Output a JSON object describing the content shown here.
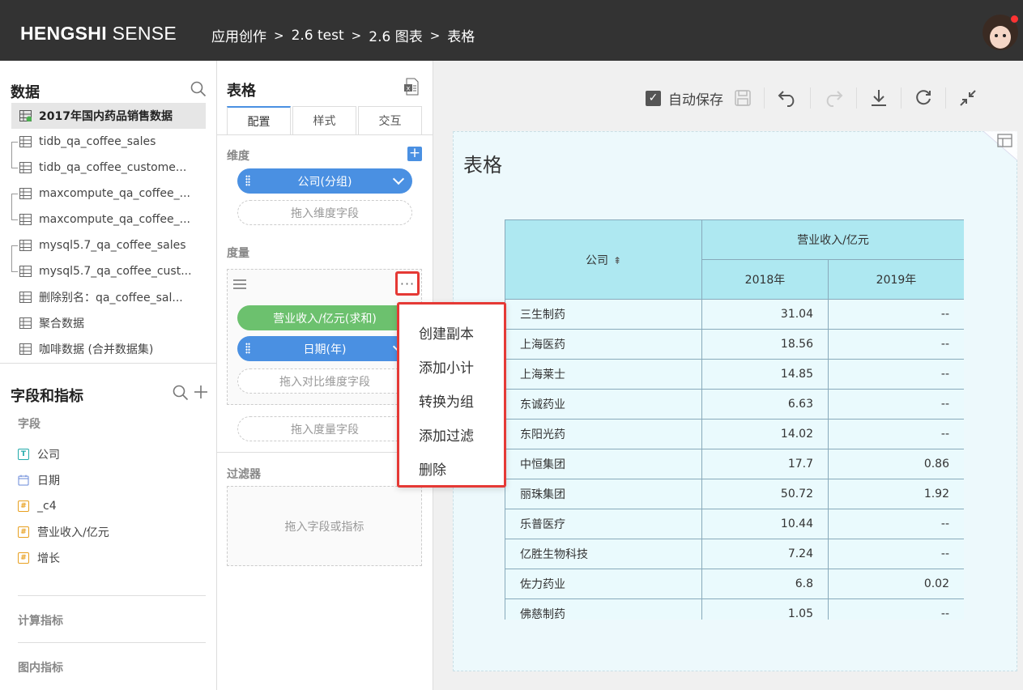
{
  "header": {
    "brand_bold": "HENGSHI",
    "brand_light": " SENSE",
    "breadcrumbs": [
      "应用创作",
      "2.6 test",
      "2.6 图表",
      "表格"
    ],
    "separator": ">"
  },
  "data_panel": {
    "title": "数据",
    "datasets": [
      {
        "label": "2017年国内药品销售数据"
      },
      {
        "label": "tidb_qa_coffee_sales"
      },
      {
        "label": "tidb_qa_coffee_custome..."
      },
      {
        "label": "maxcompute_qa_coffee_..."
      },
      {
        "label": "maxcompute_qa_coffee_..."
      },
      {
        "label": "mysql5.7_qa_coffee_sales"
      },
      {
        "label": "mysql5.7_qa_coffee_cust..."
      },
      {
        "label": "删除别名：qa_coffee_sal..."
      },
      {
        "label": "聚合数据"
      },
      {
        "label": "咖啡数据 (合并数据集)"
      }
    ]
  },
  "fields_panel": {
    "title": "字段和指标",
    "fields_label": "字段",
    "fields": [
      {
        "type": "T",
        "label": "公司"
      },
      {
        "type": "date",
        "label": "日期"
      },
      {
        "type": "#",
        "label": "_c4"
      },
      {
        "type": "#",
        "label": "营业收入/亿元"
      },
      {
        "type": "#",
        "label": "增长"
      }
    ],
    "calc_label": "计算指标",
    "inchart_label": "图内指标"
  },
  "config_panel": {
    "title": "表格",
    "tabs": [
      "配置",
      "样式",
      "交互"
    ],
    "dimension_label": "维度",
    "dimension_pill": "公司(分组)",
    "dimension_drop": "拖入维度字段",
    "measure_label": "度量",
    "measure_pill": "营业收入/亿元(求和)",
    "compare_pill": "日期(年)",
    "compare_drop": "拖入对比维度字段",
    "measure_drop": "拖入度量字段",
    "filter_label": "过滤器",
    "filter_drop": "拖入字段或指标",
    "more_glyph": "···"
  },
  "context_menu": {
    "items": [
      "创建副本",
      "添加小计",
      "转换为组",
      "添加过滤",
      "删除"
    ]
  },
  "toolbar": {
    "autosave_label": "自动保存",
    "autosave_checked": true
  },
  "chart": {
    "title": "表格"
  },
  "chart_data": {
    "type": "table",
    "row_header": "公司",
    "group_header": "营业收入/亿元",
    "columns": [
      "2018年",
      "2019年"
    ],
    "rows": [
      {
        "name": "三生制药",
        "v2018": "31.04",
        "v2019": "--"
      },
      {
        "name": "上海医药",
        "v2018": "18.56",
        "v2019": "--"
      },
      {
        "name": "上海莱士",
        "v2018": "14.85",
        "v2019": "--"
      },
      {
        "name": "东诚药业",
        "v2018": "6.63",
        "v2019": "--"
      },
      {
        "name": "东阳光药",
        "v2018": "14.02",
        "v2019": "--"
      },
      {
        "name": "中恒集团",
        "v2018": "17.7",
        "v2019": "0.86"
      },
      {
        "name": "丽珠集团",
        "v2018": "50.72",
        "v2019": "1.92"
      },
      {
        "name": "乐普医疗",
        "v2018": "10.44",
        "v2019": "--"
      },
      {
        "name": "亿胜生物科技",
        "v2018": "7.24",
        "v2019": "--"
      },
      {
        "name": "佐力药业",
        "v2018": "6.8",
        "v2019": "0.02"
      },
      {
        "name": "佛慈制药",
        "v2018": "1.05",
        "v2019": "--"
      }
    ]
  },
  "colors": {
    "header_bg": "#333333",
    "accent_blue": "#4a90e2",
    "pill_green": "#6cc16e",
    "highlight_red": "#e53935",
    "table_header": "#aee8f1",
    "table_cell": "#eafafd"
  }
}
